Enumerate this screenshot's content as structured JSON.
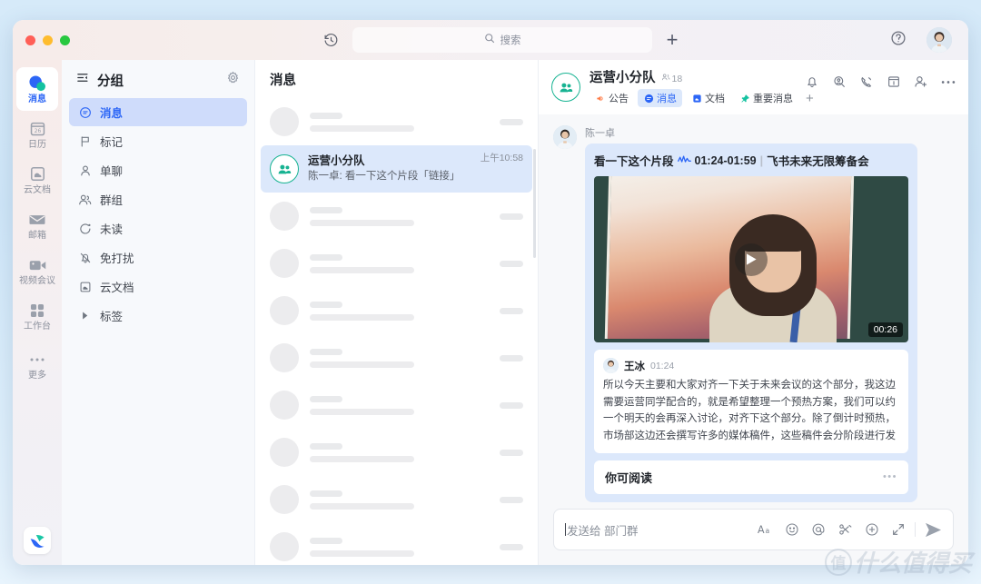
{
  "titlebar": {
    "history_icon": "history-clock-icon",
    "search": {
      "placeholder": "搜索",
      "icon": "search-icon"
    },
    "add_label": "+",
    "help_icon": "help-circle-icon",
    "avatar": "user-avatar"
  },
  "rail": {
    "items": [
      {
        "label": "消息",
        "icon": "chat-bubbles-icon",
        "active": true
      },
      {
        "label": "日历",
        "icon": "calendar-26-icon",
        "active": false
      },
      {
        "label": "云文档",
        "icon": "cloud-doc-icon",
        "active": false
      },
      {
        "label": "邮箱",
        "icon": "mail-envelope-icon",
        "active": false
      },
      {
        "label": "视频会议",
        "icon": "video-camera-icon",
        "active": false
      },
      {
        "label": "工作台",
        "icon": "grid-apps-icon",
        "active": false
      },
      {
        "label": "更多",
        "icon": "ellipsis-icon",
        "active": false
      }
    ],
    "logo": "feishu-lark-logo"
  },
  "groups": {
    "title": "分组",
    "title_icon": "collapse-list-icon",
    "settings_icon": "gear-icon",
    "items": [
      {
        "label": "消息",
        "icon": "message-icon",
        "selected": true
      },
      {
        "label": "标记",
        "icon": "flag-icon",
        "selected": false
      },
      {
        "label": "单聊",
        "icon": "person-icon",
        "selected": false
      },
      {
        "label": "群组",
        "icon": "people-icon",
        "selected": false
      },
      {
        "label": "未读",
        "icon": "unread-dot-icon",
        "selected": false
      },
      {
        "label": "免打扰",
        "icon": "bell-off-icon",
        "selected": false
      },
      {
        "label": "云文档",
        "icon": "cloud-doc-icon",
        "selected": false
      },
      {
        "label": "标签",
        "icon": "triangle-right-icon",
        "selected": false
      }
    ]
  },
  "message_list": {
    "title": "消息",
    "active_conversation": {
      "name": "运营小分队",
      "preview": "陈一卓: 看一下这个片段「链接」",
      "time": "上午10:58",
      "avatar_icon": "group-avatar-icon"
    },
    "skeleton_rows_above": 1,
    "skeleton_rows_below": 8
  },
  "chat": {
    "name": "运营小分队",
    "member_count": "18",
    "member_icon": "members-icon",
    "tabs": [
      {
        "label": "公告",
        "icon": "megaphone-icon",
        "active": false
      },
      {
        "label": "消息",
        "icon": "message-round-icon",
        "active": true
      },
      {
        "label": "文档",
        "icon": "doc-icon",
        "active": false
      },
      {
        "label": "重要消息",
        "icon": "pin-icon",
        "active": false
      }
    ],
    "add_tab_label": "+",
    "actions": [
      "bell-icon",
      "search-person-icon",
      "phone-call-icon",
      "calendar-box-icon",
      "add-member-icon",
      "more-ellipsis-icon"
    ],
    "message": {
      "sender": "陈一卓",
      "avatar": "sender-avatar",
      "clip_title": "看一下这个片段",
      "clip_wave_icon": "audio-wave-icon",
      "clip_range": "01:24-01:59",
      "clip_separator": "|",
      "clip_source": "飞书未来无限筹备会",
      "video": {
        "duration": "00:26",
        "play_icon": "play-triangle-icon"
      },
      "transcript": {
        "speaker": "王冰",
        "time": "01:24",
        "text": "所以今天主要和大家对齐一下关于未来会议的这个部分，我这边需要运营同学配合的，就是希望整理一个预热方案，我们可以约一个明天的会再深入讨论，对齐下这个部分。除了倒计时预热，市场部这边还会撰写许多的媒体稿件，这些稿件会分阶段进行发"
      },
      "read_card": {
        "title": "你可阅读",
        "more_icon": "more-ellipsis-icon"
      }
    }
  },
  "composer": {
    "placeholder": "发送给 部门群",
    "tools": [
      "font-format-icon",
      "emoji-icon",
      "mention-at-icon",
      "scissors-clip-icon",
      "plus-circle-icon",
      "expand-icon"
    ],
    "send_icon": "send-paperplane-icon"
  },
  "watermark": {
    "badge": "值",
    "text": "什么值得买"
  },
  "colors": {
    "accent": "#2c66f6",
    "selected_bg": "#dce8fb",
    "group_ring": "#17b392",
    "page_bg": "#d6eaf9"
  }
}
